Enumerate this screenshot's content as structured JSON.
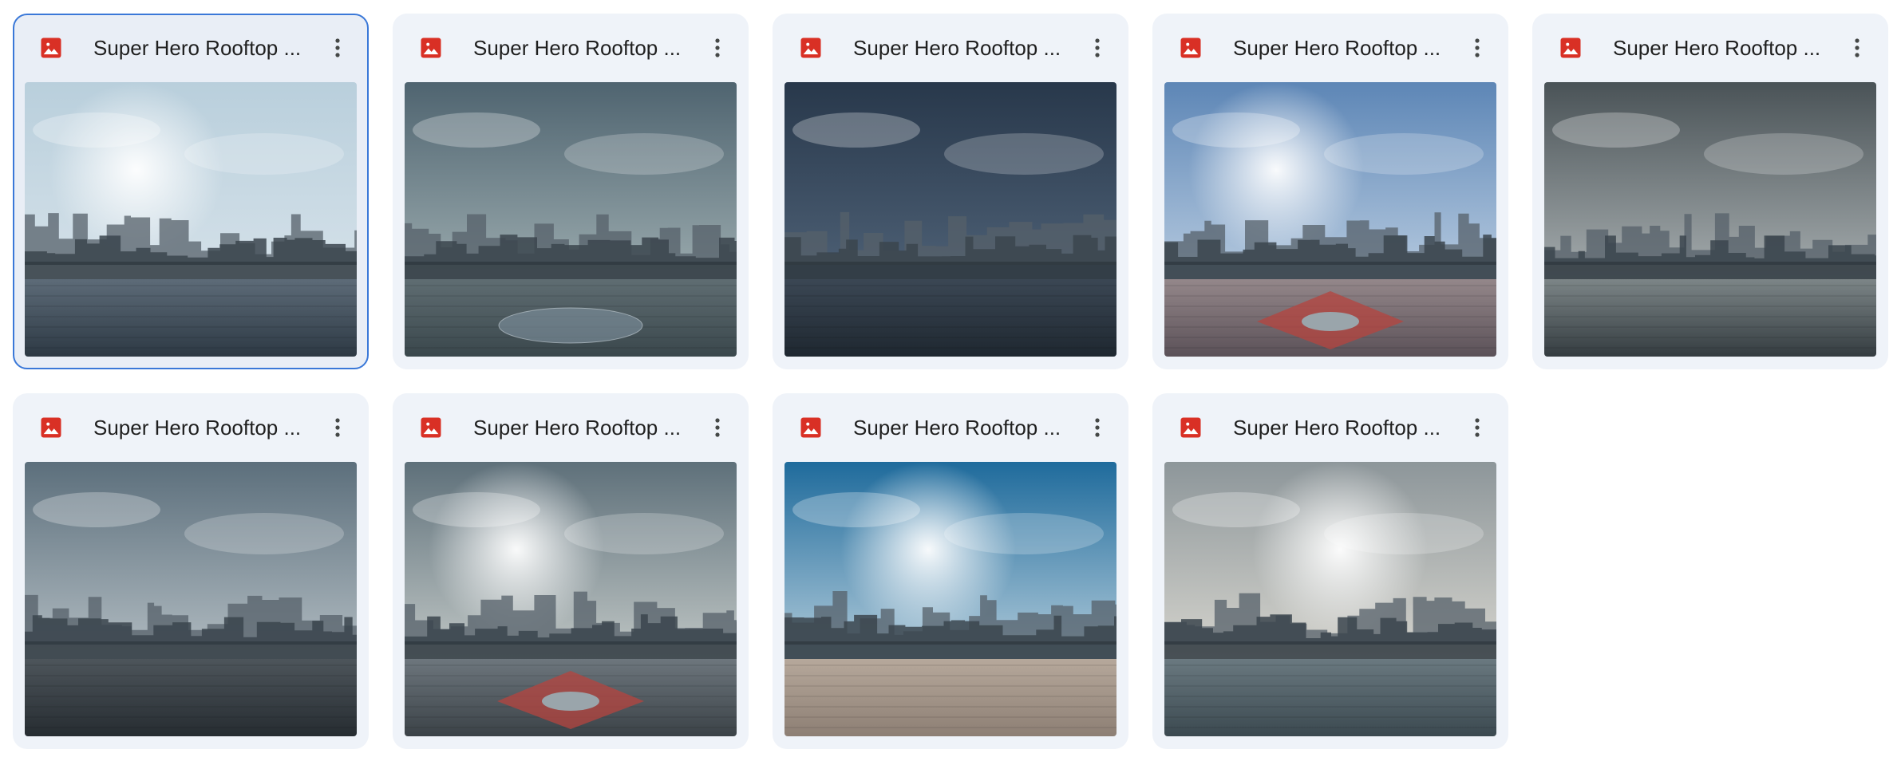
{
  "files": [
    {
      "name": "Super Hero Rooftop ...",
      "icon": "image-file-icon",
      "menu_icon": "more-vert-icon",
      "selected": true,
      "scene": {
        "sky": [
          "#b9cfdc",
          "#dfe8ee"
        ],
        "sun": true,
        "floor": [
          "#5d6b78",
          "#2d3944"
        ],
        "pad": "none"
      }
    },
    {
      "name": "Super Hero Rooftop ...",
      "icon": "image-file-icon",
      "menu_icon": "more-vert-icon",
      "selected": false,
      "scene": {
        "sky": [
          "#4f6470",
          "#b8c6c6"
        ],
        "sun": false,
        "floor": [
          "#5f6d72",
          "#3a474c"
        ],
        "pad": "circle"
      }
    },
    {
      "name": "Super Hero Rooftop ...",
      "icon": "image-file-icon",
      "menu_icon": "more-vert-icon",
      "selected": false,
      "scene": {
        "sky": [
          "#28384b",
          "#5c7086"
        ],
        "sun": false,
        "floor": [
          "#3b4754",
          "#1e2730"
        ],
        "pad": "none"
      }
    },
    {
      "name": "Super Hero Rooftop ...",
      "icon": "image-file-icon",
      "menu_icon": "more-vert-icon",
      "selected": false,
      "scene": {
        "sky": [
          "#5d86b6",
          "#d8e4ef"
        ],
        "sun": true,
        "floor": [
          "#94878a",
          "#5b5158"
        ],
        "pad": "red"
      }
    },
    {
      "name": "Super Hero Rooftop ...",
      "icon": "image-file-icon",
      "menu_icon": "more-vert-icon",
      "selected": false,
      "scene": {
        "sky": [
          "#4a5357",
          "#c9cfd0"
        ],
        "sun": false,
        "floor": [
          "#7c8587",
          "#343c40"
        ],
        "pad": "none"
      }
    },
    {
      "name": "Super Hero Rooftop ...",
      "icon": "image-file-icon",
      "menu_icon": "more-vert-icon",
      "selected": false,
      "scene": {
        "sky": [
          "#5c6f7c",
          "#d3dadd"
        ],
        "sun": false,
        "floor": [
          "#4d555b",
          "#262c31"
        ],
        "pad": "none"
      }
    },
    {
      "name": "Super Hero Rooftop ...",
      "icon": "image-file-icon",
      "menu_icon": "more-vert-icon",
      "selected": false,
      "scene": {
        "sky": [
          "#5e707a",
          "#e6e8e2"
        ],
        "sun": true,
        "floor": [
          "#6d767d",
          "#3b4247"
        ],
        "pad": "red"
      }
    },
    {
      "name": "Super Hero Rooftop ...",
      "icon": "image-file-icon",
      "menu_icon": "more-vert-icon",
      "selected": false,
      "scene": {
        "sky": [
          "#1f6b9c",
          "#eaf0f2"
        ],
        "sun": true,
        "floor": [
          "#b6a89b",
          "#8d7f74"
        ],
        "pad": "none"
      }
    },
    {
      "name": "Super Hero Rooftop ...",
      "icon": "image-file-icon",
      "menu_icon": "more-vert-icon",
      "selected": false,
      "scene": {
        "sky": [
          "#8d969a",
          "#f1ece1"
        ],
        "sun": true,
        "floor": [
          "#6a7980",
          "#3b4950"
        ],
        "pad": "none"
      }
    }
  ],
  "colors": {
    "card_bg": "#eff3f9",
    "selected_border": "#3a78d8",
    "icon_red": "#d93025",
    "text": "#1f1f1f"
  }
}
